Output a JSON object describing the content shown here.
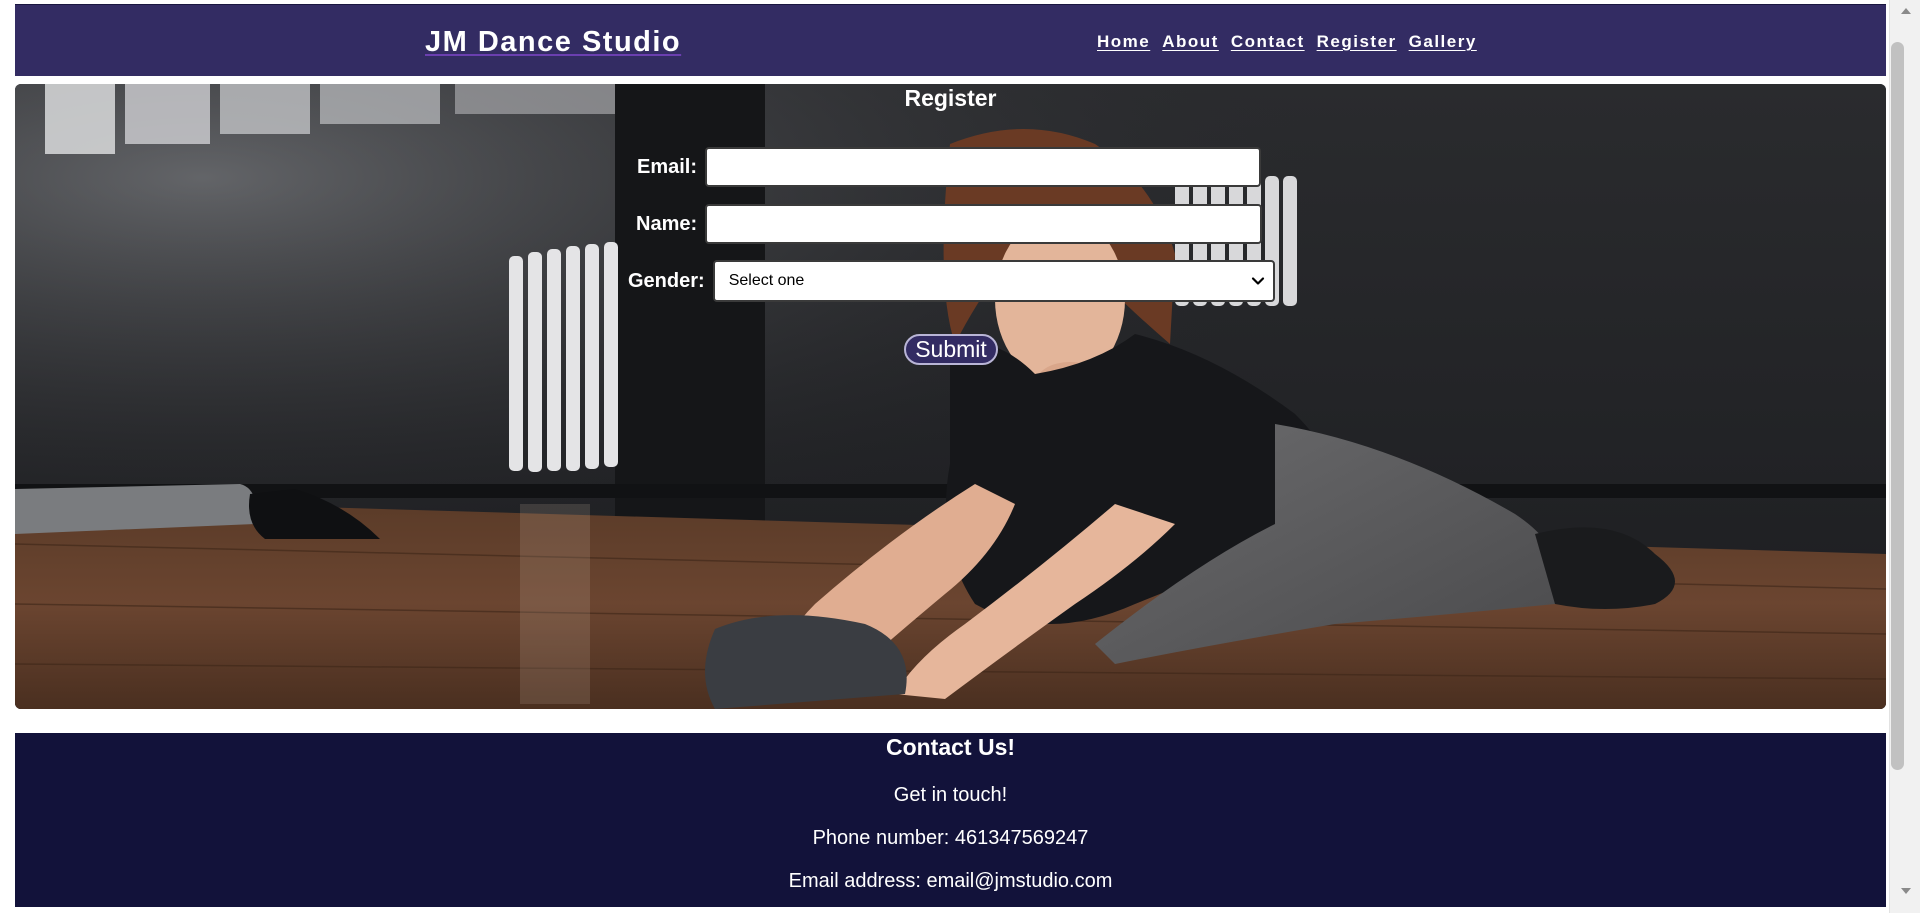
{
  "header": {
    "site_title": "JM Dance Studio",
    "nav": [
      "Home",
      "About",
      "Contact",
      "Register",
      "Gallery"
    ],
    "background_color": "#332c63"
  },
  "register": {
    "title": "Register",
    "email_label": "Email:",
    "email_value": "",
    "name_label": "Name:",
    "name_value": "",
    "gender_label": "Gender:",
    "gender_selected": "Select one",
    "submit_label": "Submit"
  },
  "footer": {
    "title": "Contact Us!",
    "tagline": "Get in touch!",
    "phone": "Phone number: 461347569247",
    "email": "Email address: email@jmstudio.com",
    "background_color": "#12123a"
  },
  "icons": [
    "chevron-down-icon",
    "scroll-up-arrow-icon",
    "scroll-down-arrow-icon"
  ]
}
